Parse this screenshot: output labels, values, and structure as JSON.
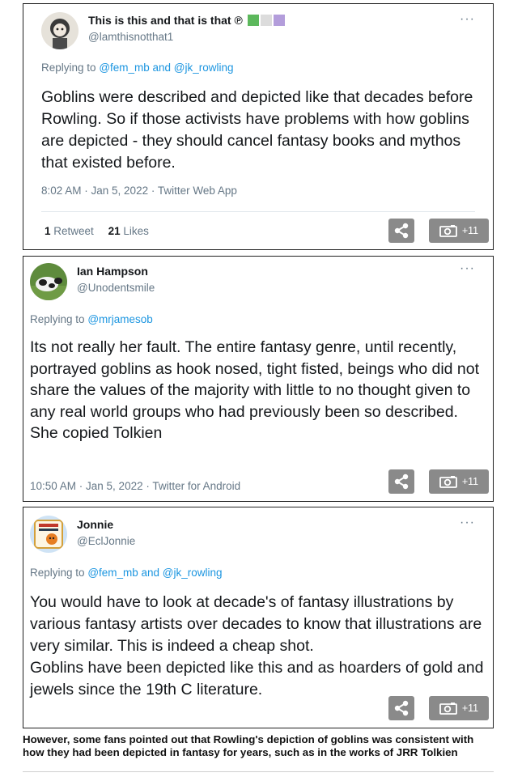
{
  "tweets": [
    {
      "display_name": "This is this and that is that ℗",
      "name_colors": [
        "#5cb85c",
        "#dcdcdc",
        "#b39ddb"
      ],
      "handle": "@lamthisnotthat1",
      "reply_prefix": "Replying to",
      "reply_mentions": "@fem_mb and @jk_rowling",
      "text": "Goblins were described and depicted like that decades before Rowling. So if those activists have problems with how goblins are depicted - they should cancel fantasy books and mythos that existed before.",
      "timestamp": "8:02 AM · Jan 5, 2022 · Twitter Web App",
      "retweets_count": "1",
      "retweets_label": "Retweet",
      "likes_count": "21",
      "likes_label": "Likes"
    },
    {
      "display_name": "Ian Hampson",
      "handle": "@Unodentsmile",
      "reply_prefix": "Replying to",
      "reply_mentions": "@mrjamesob",
      "text": "Its not really her fault. The entire fantasy genre, until recently, portrayed goblins as hook nosed, tight fisted, beings who did not share the values of the majority with little to no thought given to any real world groups who had previously been so described.\nShe copied Tolkien",
      "timestamp": "10:50 AM · Jan 5, 2022 · Twitter for Android"
    },
    {
      "display_name": "Jonnie",
      "handle": "@EclJonnie",
      "reply_prefix": "Replying to",
      "reply_mentions": "@fem_mb and @jk_rowling",
      "text": "You would have to look at decade's of fantasy illustrations by various fantasy artists over decades to know that illustrations are very similar.  This is indeed a cheap shot.\nGoblins have been depicted like this and as hoarders of gold and jewels since the 19th C literature."
    }
  ],
  "more_icon": "···",
  "gallery_label": "+11",
  "caption": "However, some fans pointed out that Rowling's depiction of goblins was consistent with how they had been depicted in fantasy for years, such as in the works of JRR Tolkien"
}
